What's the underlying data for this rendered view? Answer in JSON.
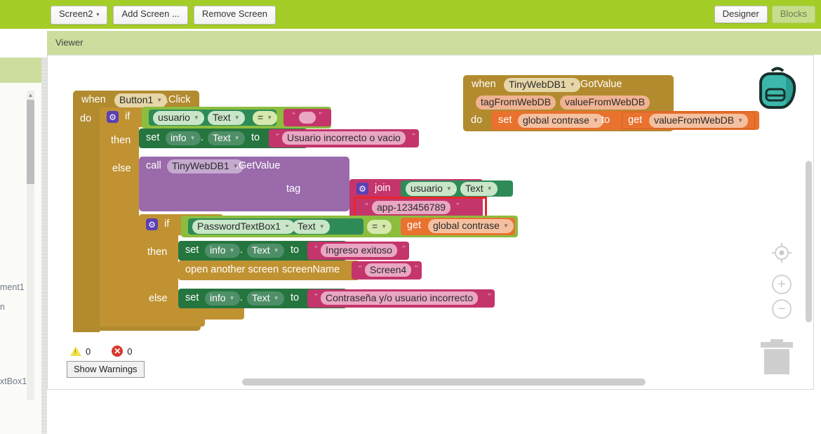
{
  "toolbar": {
    "screen_selector": "Screen2",
    "add_screen": "Add Screen ...",
    "remove_screen": "Remove Screen",
    "designer": "Designer",
    "blocks": "Blocks",
    "caret": "▼"
  },
  "left_panel": {
    "items": [
      "ment1",
      "n",
      "xtBox1"
    ],
    "scroll_up": "▲"
  },
  "viewer": {
    "title": "Viewer"
  },
  "status": {
    "warning_count": "0",
    "error_count": "0",
    "show_warnings": "Show Warnings",
    "warning_icon": "warning-triangle-icon",
    "error_icon": "error-circle-icon"
  },
  "canvas_controls": {
    "center_icon": "center-target-icon",
    "zoom_in": "+",
    "zoom_out": "−",
    "trash_icon": "trash-can-icon",
    "backpack_icon": "backpack-icon"
  },
  "blocks": {
    "button_click": {
      "when": "when",
      "component": "Button1",
      "event": ".Click",
      "do": "do"
    },
    "if_outer": {
      "if": "if",
      "then": "then",
      "else": "else",
      "gear": "⚙"
    },
    "cond1": {
      "component": "usuario",
      "property": "Text",
      "dot": ".",
      "operator": "=",
      "empty_text": ""
    },
    "set_info_1": {
      "set": "set",
      "component": "info",
      "property": "Text",
      "dot": ".",
      "to": "to",
      "value": "Usuario incorrecto o vacio"
    },
    "call_tinywebdb": {
      "call": "call",
      "component": "TinyWebDB1",
      "method": ".GetValue",
      "tag_label": "tag"
    },
    "join": {
      "gear": "⚙",
      "label": "join",
      "component": "usuario",
      "property": "Text",
      "dot": ".",
      "text_value": "app-123456789"
    },
    "if_inner": {
      "if": "if",
      "then": "then",
      "else": "else",
      "gear": "⚙"
    },
    "cond2": {
      "component": "PasswordTextBox1",
      "property": "Text",
      "dot": ".",
      "operator": "=",
      "get": "get",
      "variable": "global contrase"
    },
    "set_info_2": {
      "set": "set",
      "component": "info",
      "property": "Text",
      "dot": ".",
      "to": "to",
      "value": "Ingreso exitoso"
    },
    "open_screen": {
      "label": "open another screen",
      "param": "screenName",
      "value": "Screen4"
    },
    "set_info_3": {
      "set": "set",
      "component": "info",
      "property": "Text",
      "dot": ".",
      "to": "to",
      "value": "Contraseña y/o usuario incorrecto"
    },
    "gotvalue": {
      "when": "when",
      "component": "TinyWebDB1",
      "event": ".GotValue",
      "param1": "tagFromWebDB",
      "param2": "valueFromWebDB",
      "do": "do",
      "set": "set",
      "variable": "global contrase",
      "to": "to",
      "get": "get",
      "get_var": "valueFromWebDB"
    }
  },
  "colors": {
    "toolbar_green": "#a5cd28",
    "panel_green": "#ccdd9e",
    "event_gold": "#b28b2f",
    "control_gold": "#c09232",
    "set_green": "#25753f",
    "logic_lightgreen": "#8cbd3f",
    "getter_mint": "#c9e6c9",
    "text_crimson": "#c4356b",
    "call_purple": "#9a6aab",
    "variable_orange": "#e8722e",
    "annotation_red": "#e8262a"
  }
}
